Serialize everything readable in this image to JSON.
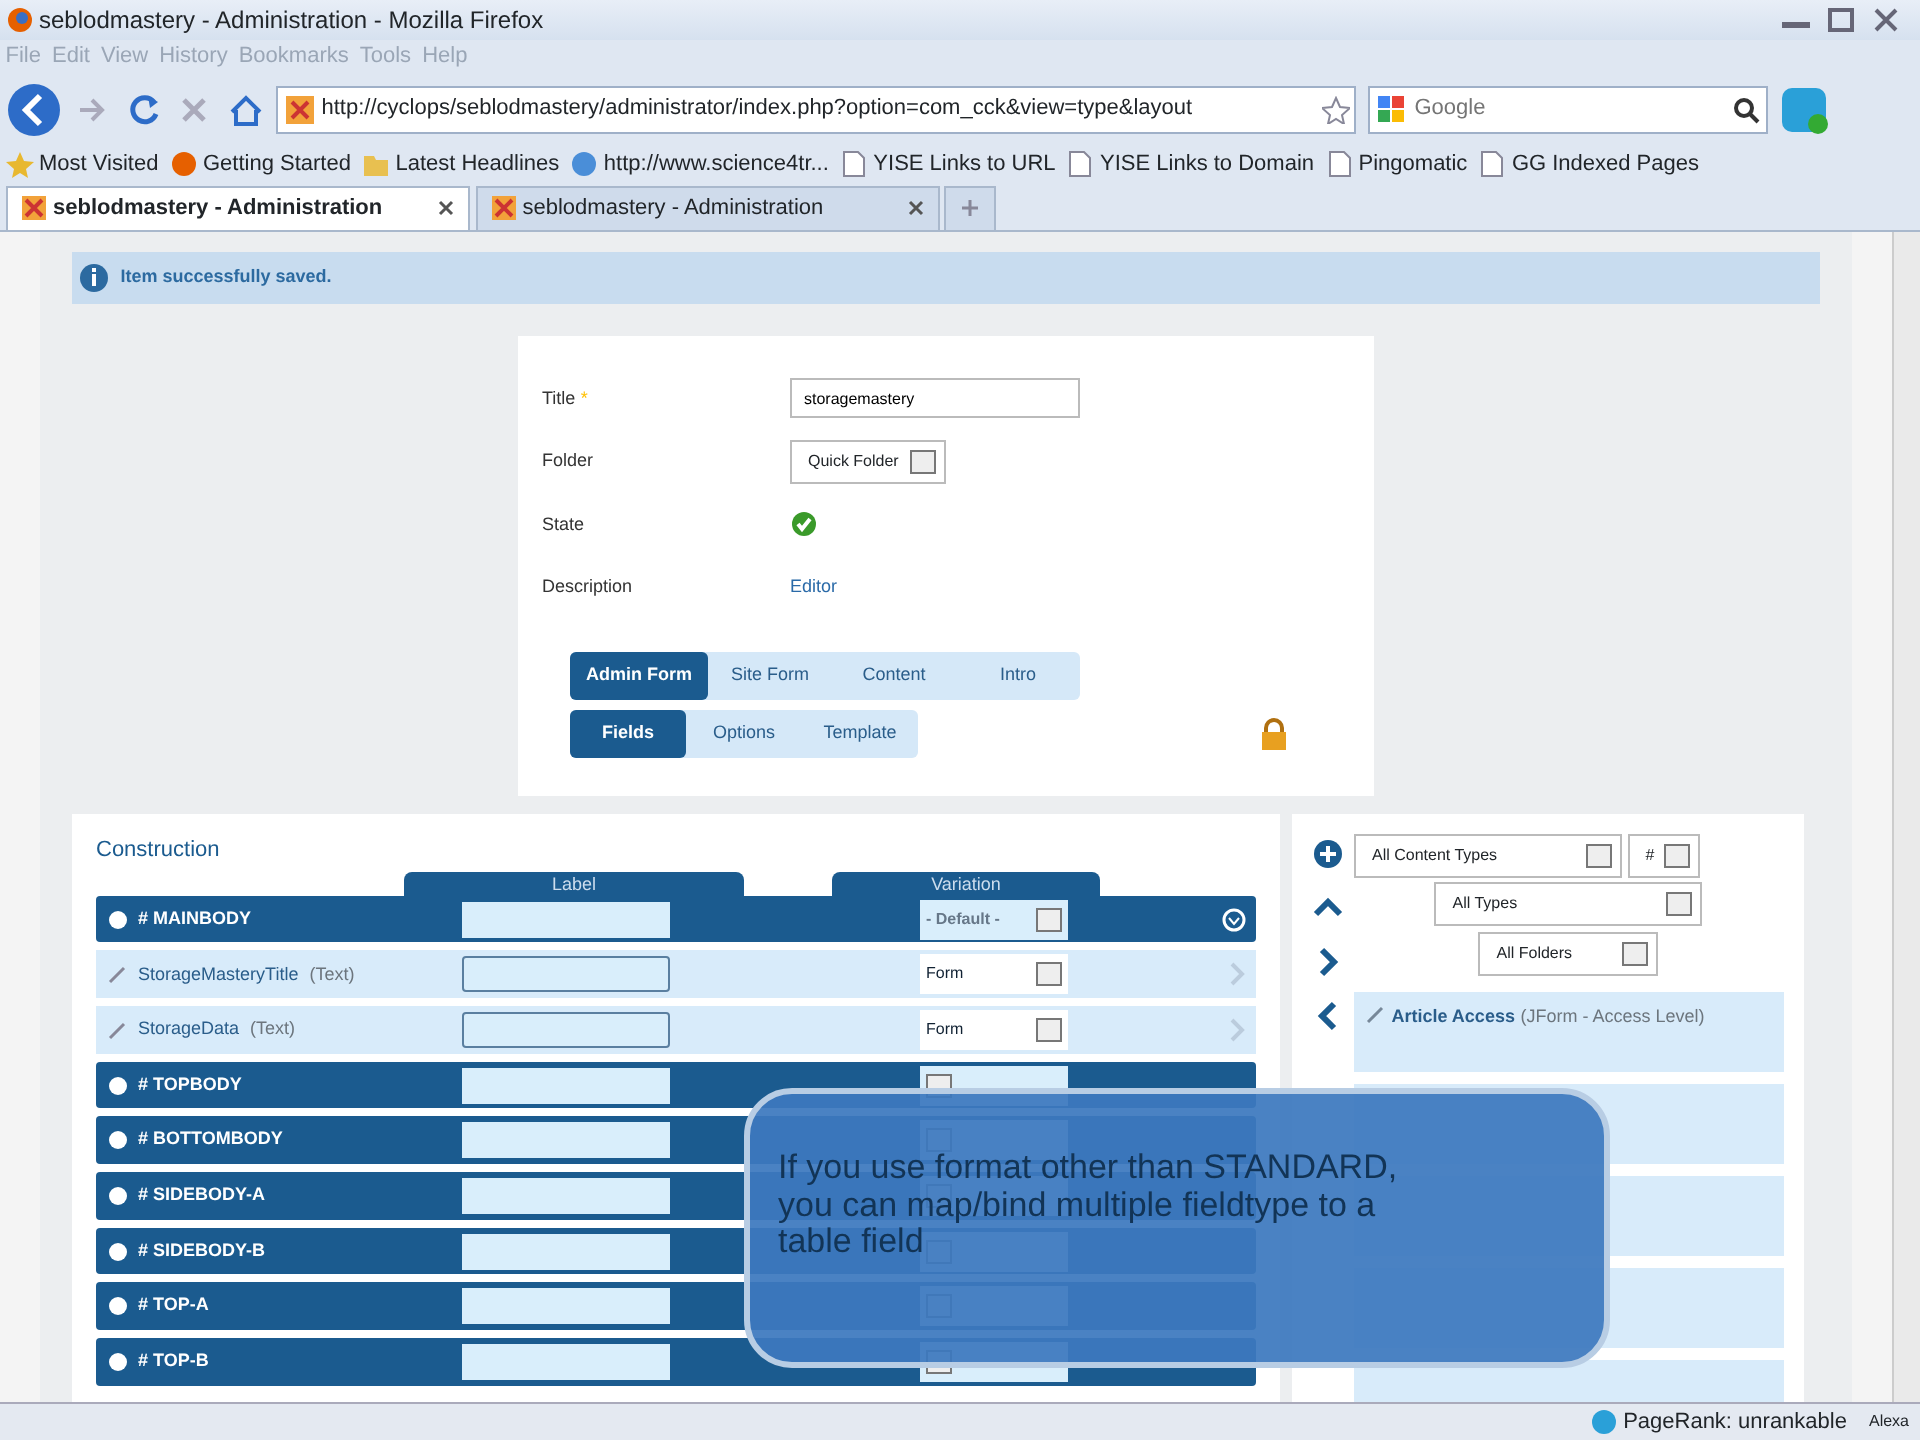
{
  "window": {
    "title": "seblodmastery - Administration - Mozilla Firefox"
  },
  "menu": [
    "File",
    "Edit",
    "View",
    "History",
    "Bookmarks",
    "Tools",
    "Help"
  ],
  "address": "http://cyclops/seblodmastery/administrator/index.php?option=com_cck&view=type&layout",
  "search": {
    "placeholder": "Google"
  },
  "bookmarks": [
    {
      "label": "Most Visited",
      "kind": "star"
    },
    {
      "label": "Getting Started",
      "kind": "globe"
    },
    {
      "label": "Latest Headlines",
      "kind": "folder"
    },
    {
      "label": "http://www.science4tr...",
      "kind": "feed"
    },
    {
      "label": "YISE Links to URL",
      "kind": "page"
    },
    {
      "label": "YISE Links to Domain",
      "kind": "page"
    },
    {
      "label": "Pingomatic",
      "kind": "page"
    },
    {
      "label": "GG Indexed Pages",
      "kind": "page"
    }
  ],
  "tabs": [
    {
      "label": "seblodmastery - Administration",
      "selected": true
    },
    {
      "label": "seblodmastery - Administration",
      "selected": false
    }
  ],
  "message": "Item successfully saved.",
  "form": {
    "fields": [
      {
        "label": "Title",
        "marker": "*",
        "kind": "input",
        "value": "storagemastery"
      },
      {
        "label": "Folder",
        "kind": "select",
        "value": "Quick Folder"
      },
      {
        "label": "State",
        "kind": "state",
        "on": true
      },
      {
        "label": "Description",
        "kind": "link",
        "value": "Editor"
      }
    ],
    "view_tabs": [
      {
        "label": "Admin Form",
        "selected": true
      },
      {
        "label": "Site Form",
        "selected": false
      },
      {
        "label": "Content",
        "selected": false
      },
      {
        "label": "Intro",
        "selected": false
      }
    ],
    "section_tabs": [
      {
        "label": "Fields",
        "selected": true
      },
      {
        "label": "Options",
        "selected": false
      },
      {
        "label": "Template",
        "selected": false
      }
    ]
  },
  "construction": {
    "title": "Construction",
    "columns": [
      "Label",
      "Variation"
    ],
    "rows": [
      {
        "kind": "position",
        "name": "# MAINBODY",
        "variation": "- Default -"
      },
      {
        "kind": "field",
        "name": "StorageMasteryTitle",
        "type": "(Text)",
        "variation": "Form"
      },
      {
        "kind": "field",
        "name": "StorageData",
        "type": "(Text)",
        "variation": "Form"
      },
      {
        "kind": "position",
        "name": "# TOPBODY"
      },
      {
        "kind": "position",
        "name": "# BOTTOMBODY"
      },
      {
        "kind": "position",
        "name": "# SIDEBODY-A"
      },
      {
        "kind": "position",
        "name": "# SIDEBODY-B"
      },
      {
        "kind": "position",
        "name": "# TOP-A"
      },
      {
        "kind": "position",
        "name": "# TOP-B"
      }
    ]
  },
  "library": {
    "filters": [
      "All Content Types",
      "#",
      "All Types",
      "All Folders"
    ],
    "items": [
      {
        "name": "Article Access",
        "type": "(JForm - Access Level)"
      }
    ]
  },
  "overlay": "If you use format other than STANDARD, you can map/bind multiple fieldtype to a table field",
  "status_bar": {
    "text": "PageRank: unrankable",
    "alexa": "Alexa"
  }
}
